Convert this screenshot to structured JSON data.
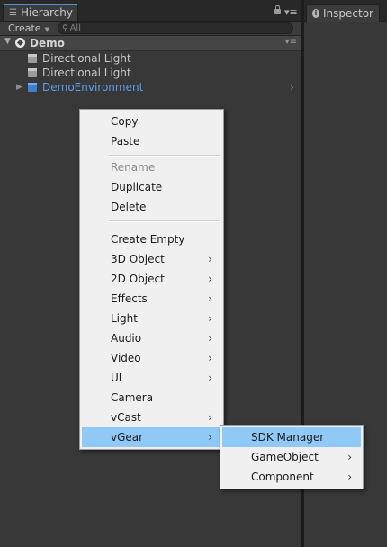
{
  "hierarchy": {
    "tab_label": "Hierarchy",
    "create_label": "Create",
    "search_placeholder": "All",
    "scene_name": "Demo",
    "objects": [
      {
        "name": "Directional Light"
      },
      {
        "name": "Directional Light"
      },
      {
        "name": "DemoEnvironment"
      }
    ]
  },
  "inspector": {
    "tab_label": "Inspector"
  },
  "context_menu": {
    "items": [
      {
        "label": "Copy"
      },
      {
        "label": "Paste"
      },
      {
        "label": "Rename"
      },
      {
        "label": "Duplicate"
      },
      {
        "label": "Delete"
      },
      {
        "label": "Create Empty"
      },
      {
        "label": "3D Object"
      },
      {
        "label": "2D Object"
      },
      {
        "label": "Effects"
      },
      {
        "label": "Light"
      },
      {
        "label": "Audio"
      },
      {
        "label": "Video"
      },
      {
        "label": "UI"
      },
      {
        "label": "Camera"
      },
      {
        "label": "vCast"
      },
      {
        "label": "vGear"
      }
    ]
  },
  "submenu": {
    "items": [
      {
        "label": "SDK Manager"
      },
      {
        "label": "GameObject"
      },
      {
        "label": "Component"
      }
    ]
  },
  "colors": {
    "selection_highlight": "#90c8f6",
    "prefab_blue": "#5a9cf0",
    "active_tab_accent": "#5a8fcf"
  }
}
